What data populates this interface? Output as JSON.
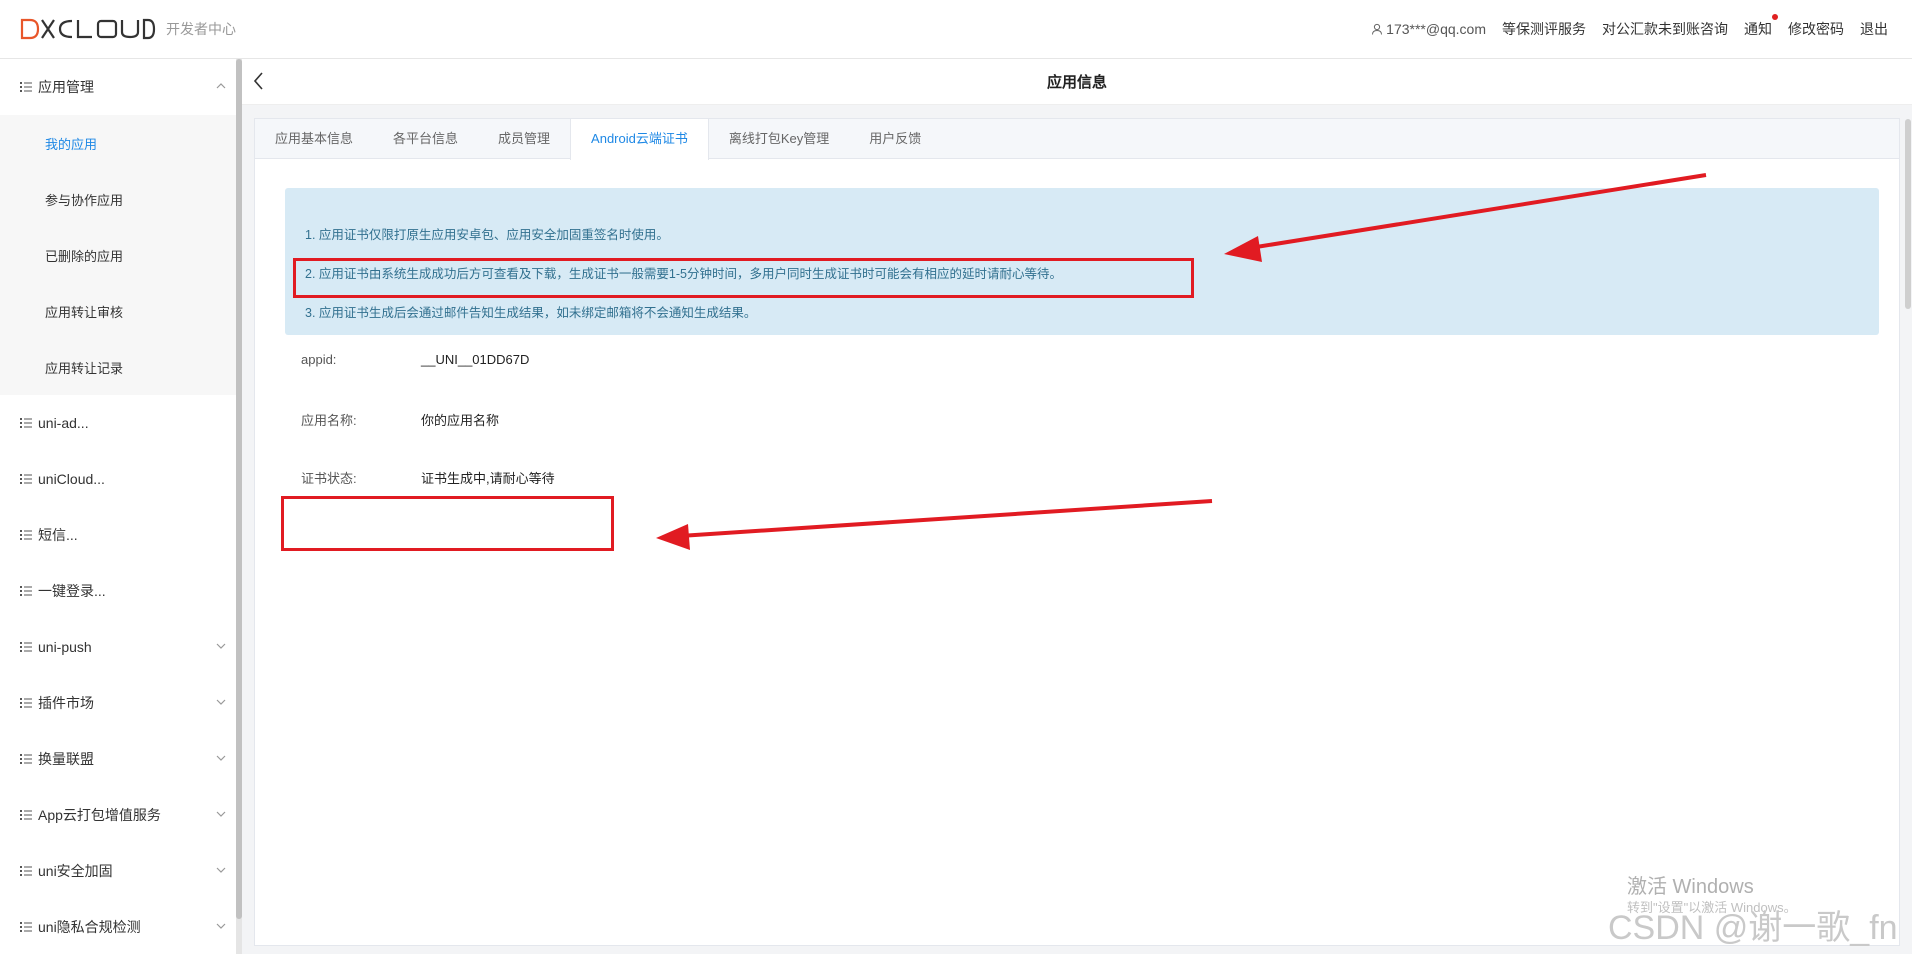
{
  "header": {
    "logo_text": "DCLOUD",
    "subtitle": "开发者中心",
    "user": "173***@qq.com",
    "links": [
      "等保测评服务",
      "对公汇款未到账咨询",
      "通知",
      "修改密码",
      "退出"
    ]
  },
  "sidebar": {
    "group_app": "应用管理",
    "sub_items": [
      "我的应用",
      "参与协作应用",
      "已删除的应用",
      "应用转让审核",
      "应用转让记录"
    ],
    "items": [
      "uni-ad...",
      "uniCloud...",
      "短信...",
      "一键登录...",
      "uni-push",
      "插件市场",
      "换量联盟",
      "App云打包增值服务",
      "uni安全加固",
      "uni隐私合规检测"
    ]
  },
  "page": {
    "title": "应用信息"
  },
  "tabs": [
    "应用基本信息",
    "各平台信息",
    "成员管理",
    "Android云端证书",
    "离线打包Key管理",
    "用户反馈"
  ],
  "notice": {
    "line1": "1. 应用证书仅限打原生应用安卓包、应用安全加固重签名时使用。",
    "line2": "2. 应用证书由系统生成成功后方可查看及下载，生成证书一般需要1-5分钟时间，多用户同时生成证书时可能会有相应的延时请耐心等待。",
    "line3": "3. 应用证书生成后会通过邮件告知生成结果，如未绑定邮箱将不会通知生成结果。"
  },
  "fields": {
    "appid_label": "appid:",
    "appid_value": "__UNI__01DD67D",
    "name_label": "应用名称:",
    "name_value": "你的应用名称",
    "status_label": "证书状态:",
    "status_value": "证书生成中,请耐心等待"
  },
  "watermark": {
    "windows": "激活 Windows",
    "windows_sub": "转到\"设置\"以激活 Windows。",
    "csdn": "CSDN @谢一歌_fn"
  },
  "colors": {
    "accent": "#1e88e5",
    "alert_bg": "#d7eaf5",
    "annotation_red": "#e11b22"
  }
}
